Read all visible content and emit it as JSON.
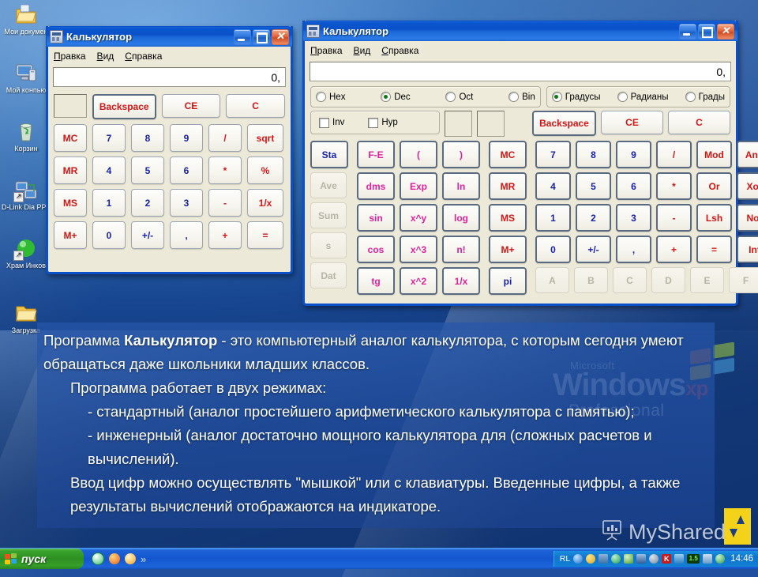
{
  "desktop": {
    "icons": [
      {
        "name": "my-documents",
        "label": "Мои докумен"
      },
      {
        "name": "my-computer",
        "label": "Мой конпью"
      },
      {
        "name": "recycle-bin",
        "label": "Корзин"
      },
      {
        "name": "dlink-dialup",
        "label": "D-Link Dia PPP Conn"
      },
      {
        "name": "hram-inkov",
        "label": "Храм Инков"
      },
      {
        "name": "downloads",
        "label": "Загрузка"
      }
    ]
  },
  "standard_calc": {
    "title": "Калькулятор",
    "menu": [
      "Правка",
      "Вид",
      "Справка"
    ],
    "display": "0,",
    "top_row": [
      "Backspace",
      "CE",
      "C"
    ],
    "keys": [
      [
        "MC",
        "7",
        "8",
        "9",
        "/",
        "sqrt"
      ],
      [
        "MR",
        "4",
        "5",
        "6",
        "*",
        "%"
      ],
      [
        "MS",
        "1",
        "2",
        "3",
        "-",
        "1/x"
      ],
      [
        "M+",
        "0",
        "+/-",
        ",",
        "+",
        "="
      ]
    ]
  },
  "scientific_calc": {
    "title": "Калькулятор",
    "menu": [
      "Правка",
      "Вид",
      "Справка"
    ],
    "display": "0,",
    "base_radios": [
      {
        "label": "Hex",
        "selected": false
      },
      {
        "label": "Dec",
        "selected": true
      },
      {
        "label": "Oct",
        "selected": false
      },
      {
        "label": "Bin",
        "selected": false
      }
    ],
    "angle_radios": [
      {
        "label": "Градусы",
        "selected": true
      },
      {
        "label": "Радианы",
        "selected": false
      },
      {
        "label": "Грады",
        "selected": false
      }
    ],
    "checks": [
      {
        "label": "Inv",
        "checked": false
      },
      {
        "label": "Hyp",
        "checked": false
      }
    ],
    "top_row": [
      "Backspace",
      "CE",
      "C"
    ],
    "stat_column": [
      "Sta",
      "Ave",
      "Sum",
      "s",
      "Dat"
    ],
    "func_grid": [
      [
        "F-E",
        "(",
        ")"
      ],
      [
        "dms",
        "Exp",
        "ln"
      ],
      [
        "sin",
        "x^y",
        "log"
      ],
      [
        "cos",
        "x^3",
        "n!"
      ],
      [
        "tg",
        "x^2",
        "1/x"
      ]
    ],
    "mem_column": [
      "MC",
      "MR",
      "MS",
      "M+",
      "pi"
    ],
    "num_grid": [
      [
        "7",
        "8",
        "9",
        "/",
        "Mod",
        "And"
      ],
      [
        "4",
        "5",
        "6",
        "*",
        "Or",
        "Xor"
      ],
      [
        "1",
        "2",
        "3",
        "-",
        "Lsh",
        "Not"
      ],
      [
        "0",
        "+/-",
        ",",
        "+",
        "=",
        "Int"
      ],
      [
        "A",
        "B",
        "C",
        "D",
        "E",
        "F"
      ]
    ]
  },
  "text_panel": {
    "line1_pre": "    Программа ",
    "line1_bold": "Калькулятор",
    "line1_post": " - это компьютерный аналог калькулятора, с которым сегодня умеют обращаться даже школьники младших классов.",
    "line2": "Программа работает в двух режимах:",
    "line3": "- стандартный (аналог простейшего арифметического калькулятора с памятью);",
    "line4": "- инженерный (аналог достаточно мощного калькулятора для (сложных расчетов и вычислений).",
    "line5": "Ввод цифр можно осуществлять \"мышкой\" или с клавиатуры. Введенные цифры, а также результаты вычислений отображаются на индикаторе."
  },
  "watermark": {
    "microsoft": "Microsoft",
    "windows": "Windows",
    "xp": "xp",
    "professional": "Professional"
  },
  "branding": {
    "myshared": "MyShared"
  },
  "taskbar": {
    "start": "пуск",
    "chevron": "»",
    "lang": "RL",
    "clock": "14:46",
    "volume_badge": "1.5"
  }
}
